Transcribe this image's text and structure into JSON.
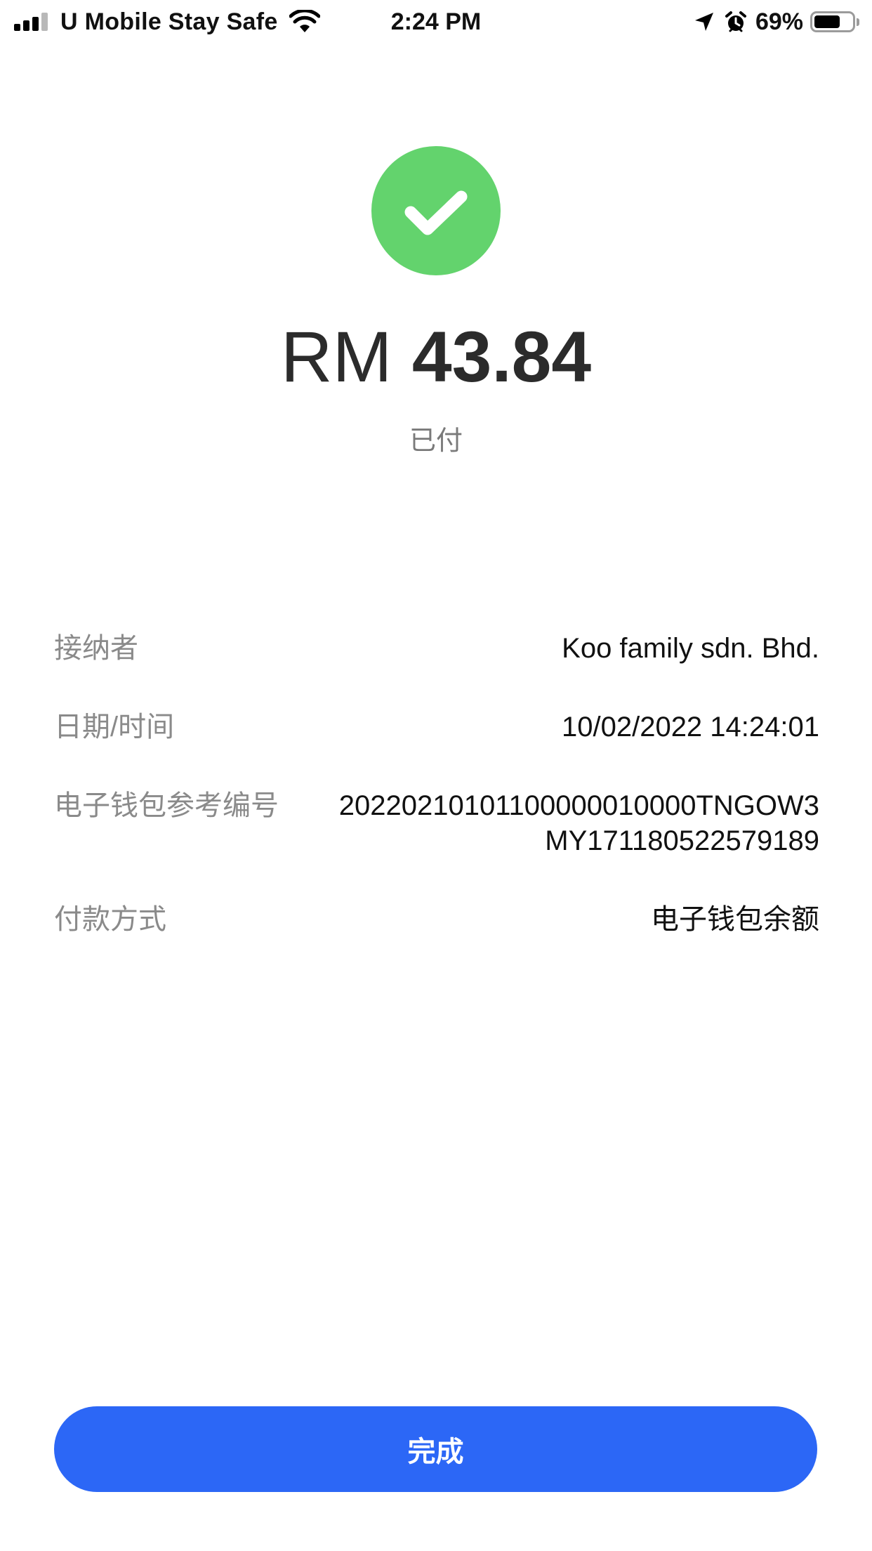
{
  "status_bar": {
    "carrier": "U Mobile Stay Safe",
    "time": "2:24 PM",
    "battery_percent": "69%",
    "battery_level": 0.69,
    "signal_bars_active": 3,
    "signal_bars_total": 4,
    "icons": [
      "signal-icon",
      "wifi-icon",
      "location-arrow-icon",
      "alarm-icon",
      "battery-icon"
    ]
  },
  "receipt": {
    "status_icon": "checkmark-icon",
    "status_icon_color": "#63d36d",
    "currency": "RM",
    "amount": "43.84",
    "status_text": "已付"
  },
  "details": {
    "rows": [
      {
        "label": "接纳者",
        "value": "Koo family sdn. Bhd."
      },
      {
        "label": "日期/时间",
        "value": "10/02/2022 14:24:01"
      },
      {
        "label": "电子钱包参考编号",
        "value": "20220210101100000010000TNGOW3MY171180522579189"
      },
      {
        "label": "付款方式",
        "value": "电子钱包余额"
      }
    ]
  },
  "footer": {
    "done_label": "完成",
    "button_color": "#2c67f6"
  }
}
